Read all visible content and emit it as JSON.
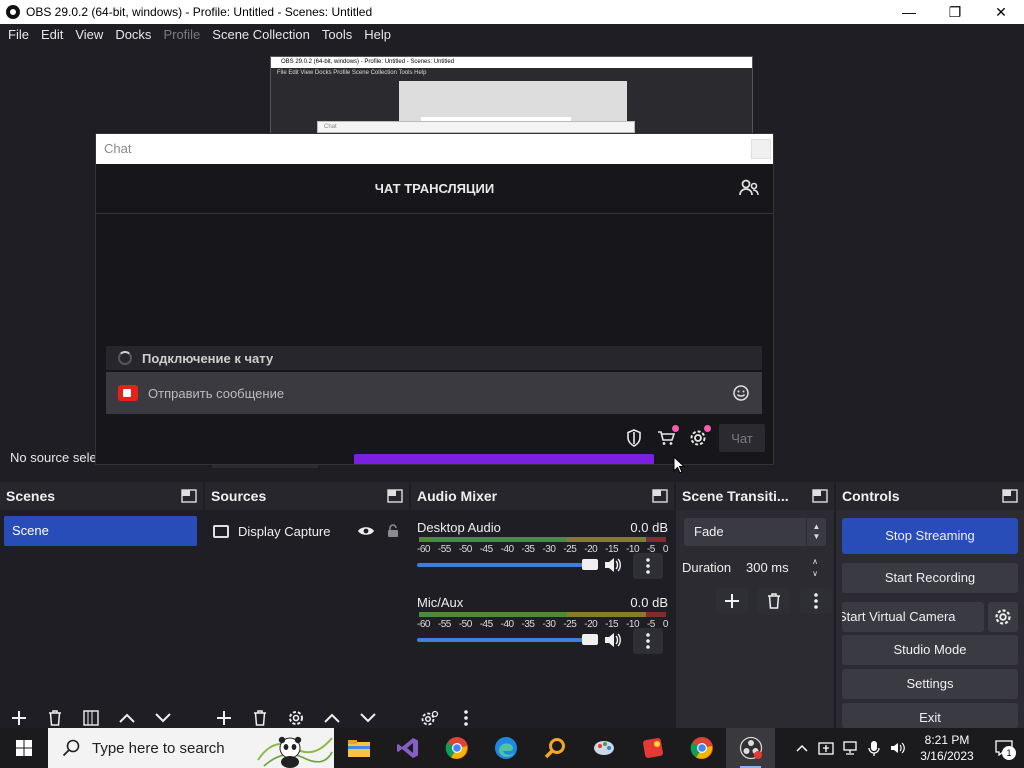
{
  "window": {
    "title": "OBS 29.0.2 (64-bit, windows) - Profile: Untitled - Scenes: Untitled",
    "minimize": "—",
    "maximize": "❐",
    "close": "✕"
  },
  "menu": [
    "File",
    "Edit",
    "View",
    "Docks",
    "Profile",
    "Scene Collection",
    "Tools",
    "Help"
  ],
  "nested_preview": {
    "title": "OBS 29.0.2 (64-bit, windows) - Profile: Untitled - Scenes: Untitled",
    "menu": "File   Edit   View   Docks   Profile   Scene Collection   Tools   Help",
    "inner_label": "Chat"
  },
  "preview": {
    "no_source_text": "No source sele"
  },
  "chat": {
    "window_title": "Chat",
    "heading": "ЧАТ ТРАНСЛЯЦИИ",
    "status": "Подключение к чату",
    "input_placeholder": "Отправить сообщение",
    "send_label": "Чат",
    "accent_color": "#7b1fe0"
  },
  "docks": {
    "scenes": {
      "title": "Scenes",
      "items": [
        "Scene"
      ]
    },
    "sources": {
      "title": "Sources",
      "items": [
        {
          "name": "Display Capture",
          "visible": true,
          "locked": false
        }
      ]
    },
    "audio_mixer": {
      "title": "Audio Mixer",
      "ticks": [
        "-60",
        "-55",
        "-50",
        "-45",
        "-40",
        "-35",
        "-30",
        "-25",
        "-20",
        "-15",
        "-10",
        "-5",
        "0"
      ],
      "tracks": [
        {
          "name": "Desktop Audio",
          "db": "0.0 dB"
        },
        {
          "name": "Mic/Aux",
          "db": "0.0 dB"
        }
      ]
    },
    "transitions": {
      "title": "Scene Transiti...",
      "selected": "Fade",
      "duration_label": "Duration",
      "duration_value": "300 ms"
    },
    "controls": {
      "title": "Controls",
      "stop_streaming": "Stop Streaming",
      "start_recording": "Start Recording",
      "start_virtual_camera": "Start Virtual Camera",
      "studio_mode": "Studio Mode",
      "settings": "Settings",
      "exit": "Exit"
    }
  },
  "taskbar": {
    "search_placeholder": "Type here to search",
    "apps": [
      "file-explorer",
      "visual-studio",
      "chrome",
      "edge",
      "search-tool",
      "paint-app",
      "media-app",
      "chrome",
      "obs-studio"
    ],
    "time": "8:21 PM",
    "date": "3/16/2023",
    "notification_count": "1"
  },
  "colors": {
    "accent_blue": "#284cb8",
    "background": "#1f1e24",
    "panel": "#2b2b31"
  }
}
